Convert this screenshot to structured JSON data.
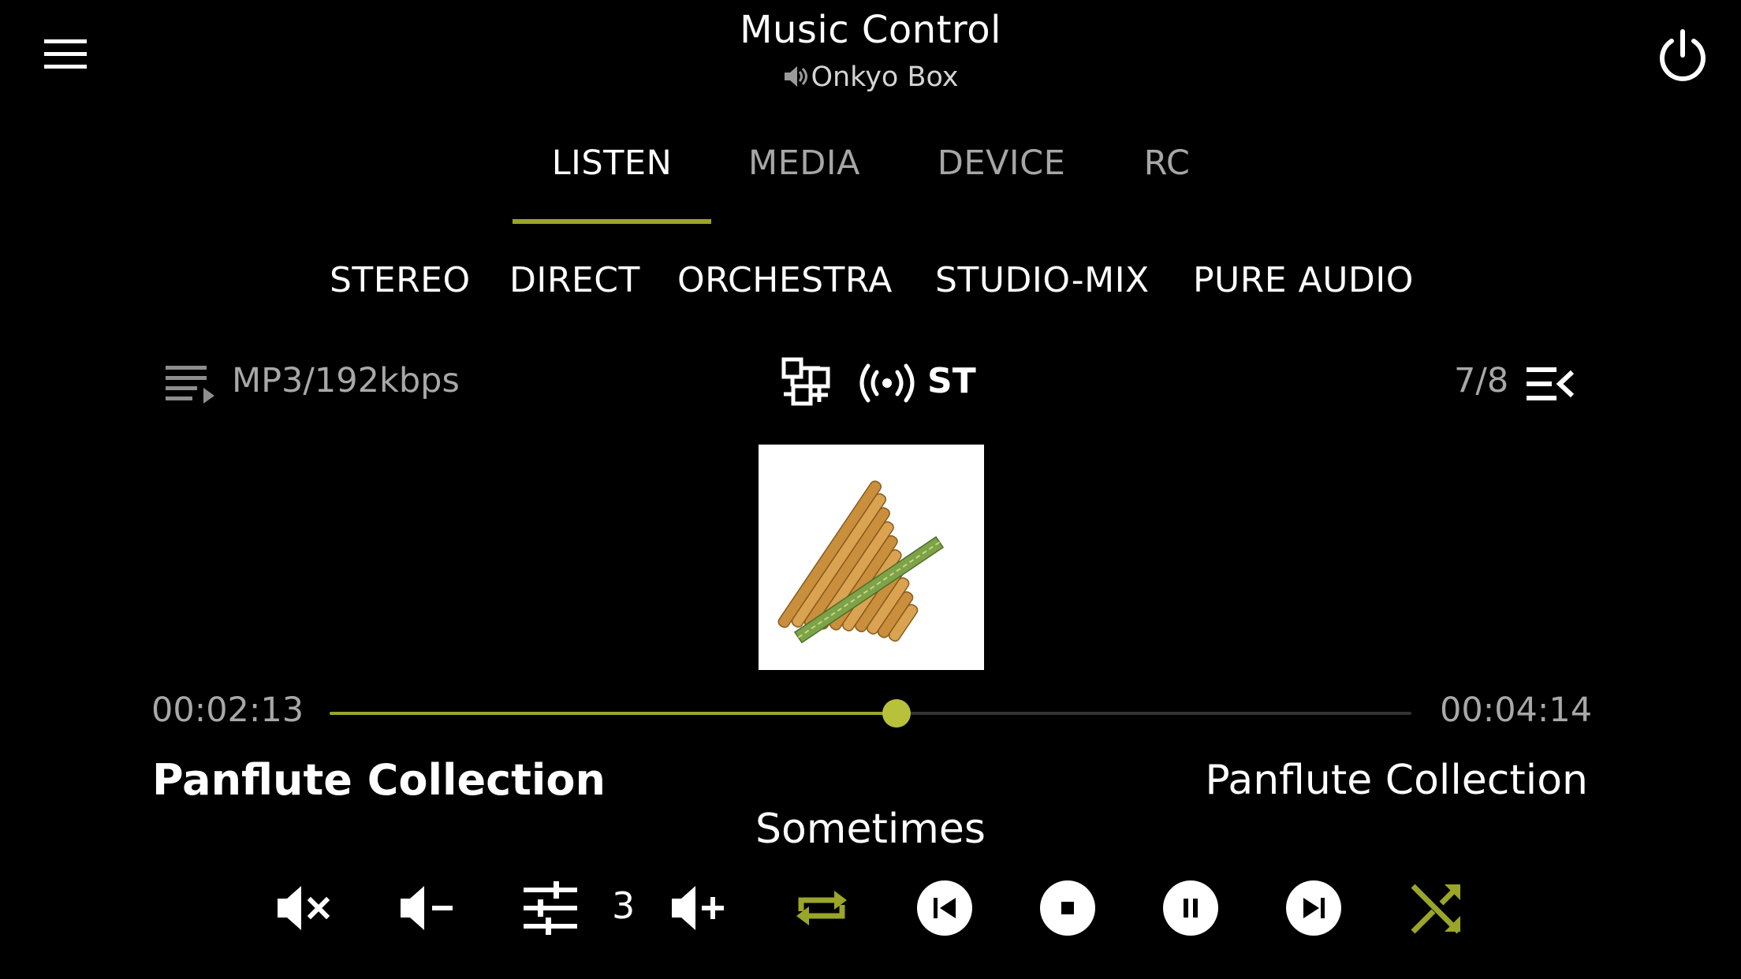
{
  "header": {
    "title": "Music Control",
    "device_name": "Onkyo Box",
    "icons": {
      "menu": "hamburger-menu-icon",
      "power": "power-icon",
      "speaker": "speaker-icon"
    }
  },
  "tabs": [
    {
      "label": "LISTEN",
      "active": true
    },
    {
      "label": "MEDIA",
      "active": false
    },
    {
      "label": "DEVICE",
      "active": false
    },
    {
      "label": "RC",
      "active": false
    }
  ],
  "sound_modes": [
    "STEREO",
    "DIRECT",
    "ORCHESTRA",
    "STUDIO-MIX",
    "PURE AUDIO"
  ],
  "status": {
    "format": "MP3/192kbps",
    "signal": "ST",
    "track_counter": "7/8"
  },
  "player": {
    "current_time": "00:02:13",
    "total_time": "00:04:14",
    "progress_fraction": 0.524,
    "album": "Panflute Collection",
    "artist": "Panflute Collection",
    "song": "Sometimes",
    "volume_level": "3"
  },
  "colors": {
    "accent": "#9aa52a",
    "thumb": "#b8c13a",
    "inactive_text": "#a6a6a6",
    "background": "#000000"
  }
}
